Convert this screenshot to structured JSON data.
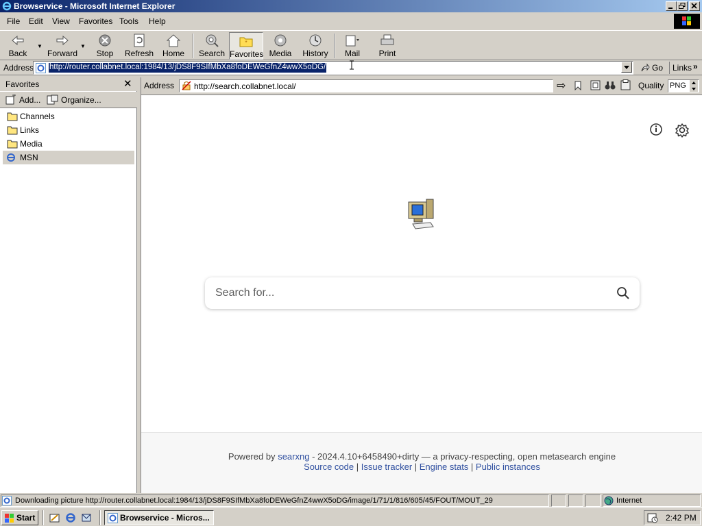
{
  "window": {
    "title": "Browservice - Microsoft Internet Explorer"
  },
  "menu": [
    "File",
    "Edit",
    "View",
    "Favorites",
    "Tools",
    "Help"
  ],
  "toolbar": {
    "back": "Back",
    "forward": "Forward",
    "stop": "Stop",
    "refresh": "Refresh",
    "home": "Home",
    "search": "Search",
    "favorites": "Favorites",
    "media": "Media",
    "history": "History",
    "mail": "Mail",
    "print": "Print"
  },
  "address": {
    "label": "Address",
    "url": "http://router.collabnet.local:1984/13/jDS8F9SIfMbXa8foDEWeGfnZ4wwX5oDG/",
    "go": "Go",
    "links": "Links"
  },
  "favorites_pane": {
    "title": "Favorites",
    "add": "Add...",
    "organize": "Organize...",
    "items": [
      "Channels",
      "Links",
      "Media",
      "MSN"
    ],
    "selected": "MSN"
  },
  "inner_bar": {
    "label": "Address",
    "url": "http://search.collabnet.local/",
    "quality_label": "Quality",
    "quality_value": "PNG"
  },
  "page": {
    "search_placeholder": "Search for...",
    "footer_powered": "Powered by",
    "footer_link": "searxng",
    "footer_rest": "- 2024.4.10+6458490+dirty — a privacy-respecting, open metasearch engine",
    "links": [
      "Source code",
      "Issue tracker",
      "Engine stats",
      "Public instances"
    ]
  },
  "status": {
    "text": "Downloading picture http://router.collabnet.local:1984/13/jDS8F9SIfMbXa8foDEWeGfnZ4wwX5oDG/image/1/71/1/816/605/45/FOUT/MOUT_29",
    "zone": "Internet"
  },
  "taskbar": {
    "start": "Start",
    "task": "Browservice - Micros...",
    "clock": "2:42 PM"
  }
}
